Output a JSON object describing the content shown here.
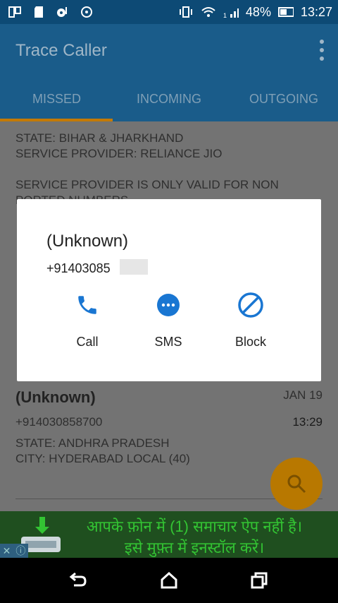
{
  "status_bar": {
    "battery": "48%",
    "time": "13:27",
    "icons": [
      "gallery-icon",
      "sd-card-icon",
      "music-icon",
      "sync-icon",
      "vibrate-icon",
      "wifi-icon",
      "signal-icon",
      "battery-icon"
    ]
  },
  "app": {
    "title": "Trace Caller"
  },
  "tabs": [
    {
      "label": "MISSED",
      "selected": true
    },
    {
      "label": "INCOMING",
      "selected": false
    },
    {
      "label": "OUTGOING",
      "selected": false
    }
  ],
  "background_list": {
    "state": "STATE: BIHAR & JHARKHAND",
    "provider": "SERVICE PROVIDER: RELIANCE JIO",
    "note_line1": "SERVICE PROVIDER IS ONLY VALID FOR NON",
    "note_line2": "PORTED NUMBERS",
    "entry": {
      "name": "(Unknown)",
      "date": "JAN 19",
      "number": "+914030858700",
      "time": "13:29",
      "state": "STATE: ANDHRA PRADESH",
      "city": "CITY: HYDERABAD LOCAL (40)"
    }
  },
  "dialog": {
    "title": "(Unknown)",
    "number": "+91403085",
    "actions": [
      {
        "label": "Call",
        "icon": "phone-icon"
      },
      {
        "label": "SMS",
        "icon": "sms-icon"
      },
      {
        "label": "Block",
        "icon": "block-icon"
      }
    ],
    "accent": "#1976d2"
  },
  "ad": {
    "line1": "आपके फ़ोन में (1) समाचार ऐप नहीं है।",
    "line2": "इसे मुफ़्त में इनस्टॉल करें।"
  },
  "colors": {
    "app_bar": "#1a5c8a",
    "fab": "#b87800",
    "ad_text": "#33c433"
  }
}
